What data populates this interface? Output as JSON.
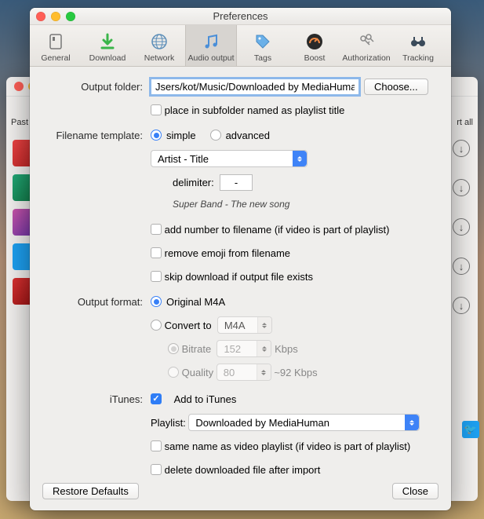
{
  "window": {
    "title": "Preferences"
  },
  "tabs": {
    "general": "General",
    "download": "Download",
    "network": "Network",
    "audio": "Audio output",
    "tags": "Tags",
    "boost": "Boost",
    "auth": "Authorization",
    "tracking": "Tracking"
  },
  "outputFolder": {
    "label": "Output folder:",
    "value": "Jsers/kot/Music/Downloaded by MediaHuman",
    "choose": "Choose...",
    "subfolder": "place in subfolder named as playlist title"
  },
  "filenameTemplate": {
    "label": "Filename template:",
    "simple": "simple",
    "advanced": "advanced",
    "pattern": "Artist - Title",
    "delimiterLabel": "delimiter:",
    "delimiterValue": "-",
    "example": "Super Band - The new song",
    "addNumber": "add number to filename (if video is part of playlist)",
    "removeEmoji": "remove emoji from filename",
    "skipExisting": "skip download if output file exists"
  },
  "outputFormat": {
    "label": "Output format:",
    "original": "Original M4A",
    "convertTo": "Convert to",
    "format": "M4A",
    "bitrateLabel": "Bitrate",
    "bitrateValue": "152",
    "bitrateUnit": "Kbps",
    "qualityLabel": "Quality",
    "qualityValue": "80",
    "qualityHint": "~92 Kbps"
  },
  "itunes": {
    "label": "iTunes:",
    "add": "Add to iTunes",
    "playlistLabel": "Playlist:",
    "playlistValue": "Downloaded by MediaHuman",
    "sameName": "same name as video playlist (if video is part of playlist)",
    "deleteAfter": "delete downloaded file after import"
  },
  "footer": {
    "restore": "Restore Defaults",
    "close": "Close"
  },
  "bg": {
    "past": "Past",
    "rtall": "rt all"
  }
}
